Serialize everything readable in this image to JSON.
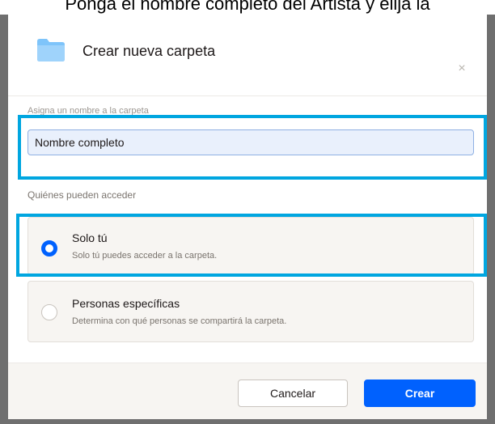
{
  "page": {
    "top_caption": "Ponga el nombre completo del Artista y elija la"
  },
  "dialog": {
    "title": "Crear nueva carpeta",
    "close_glyph": "×",
    "folder_color": "#7ec4fa"
  },
  "name_field": {
    "label": "Asigna un nombre a la carpeta",
    "value": "Nombre completo"
  },
  "access": {
    "label": "Quiénes pueden acceder",
    "options": [
      {
        "title": "Solo tú",
        "description": "Solo tú puedes acceder a la carpeta.",
        "selected": true
      },
      {
        "title": "Personas específicas",
        "description": "Determina con qué personas se compartirá la carpeta.",
        "selected": false
      }
    ]
  },
  "footer": {
    "cancel_label": "Cancelar",
    "create_label": "Crear"
  },
  "colors": {
    "accent": "#0061fe",
    "highlight": "#00a6e0"
  }
}
